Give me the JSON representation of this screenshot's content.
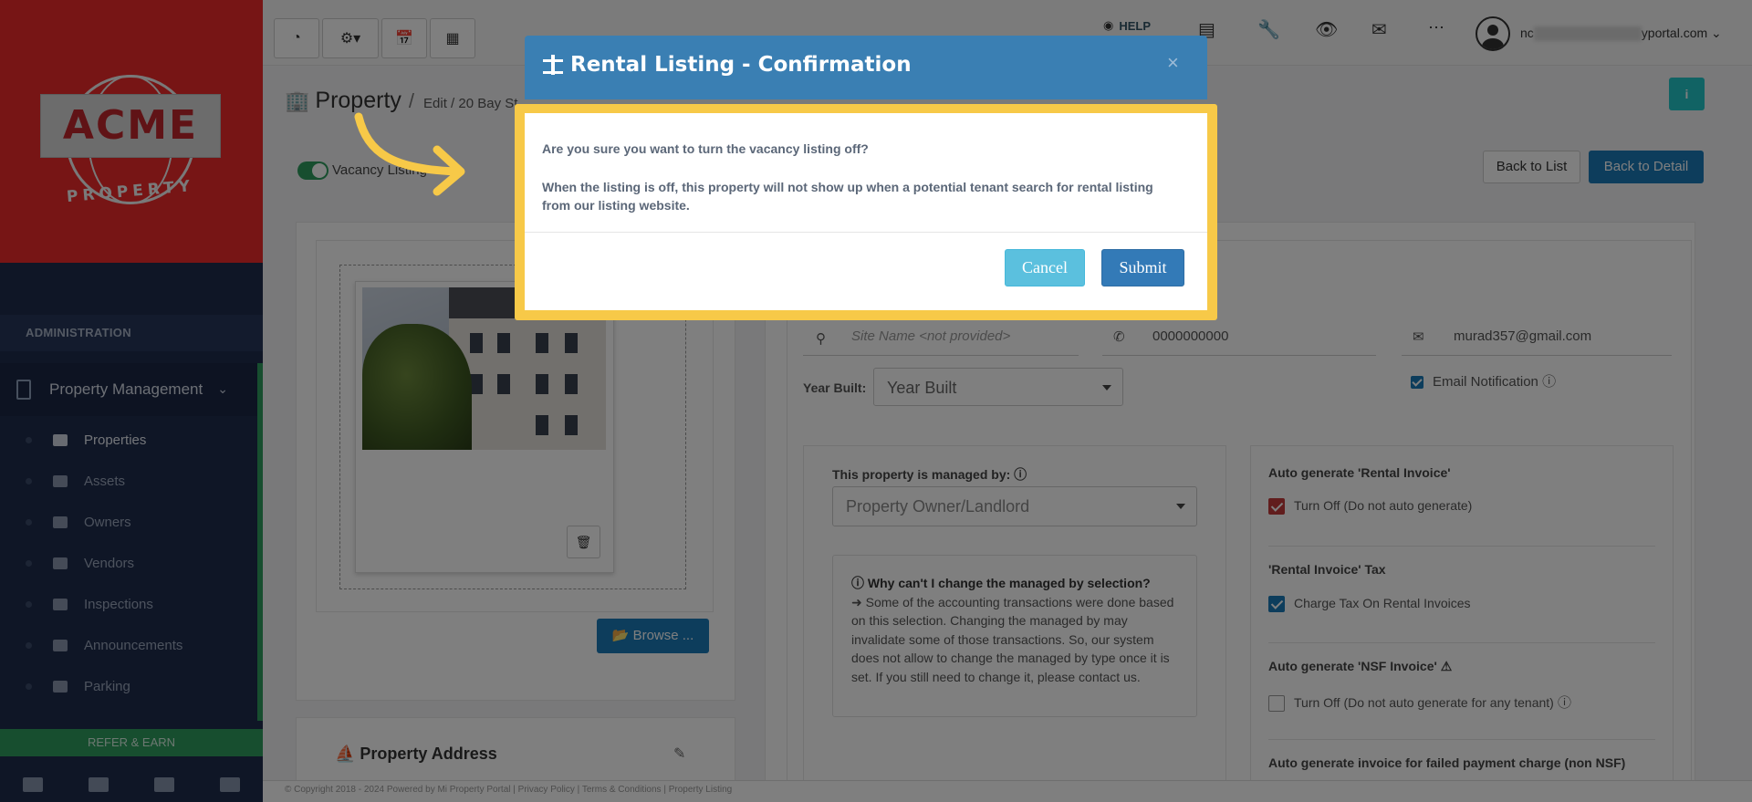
{
  "brand": {
    "logo_text": "ACME",
    "logo_sub": "PROPERTY"
  },
  "sidebar": {
    "section_label": "ADMINISTRATION",
    "group_label": "Property Management",
    "items": [
      {
        "label": "Properties",
        "icon": "home-icon",
        "active": true
      },
      {
        "label": "Assets",
        "icon": "box-icon"
      },
      {
        "label": "Owners",
        "icon": "user-icon"
      },
      {
        "label": "Vendors",
        "icon": "briefcase-icon"
      },
      {
        "label": "Inspections",
        "icon": "search-plus-icon"
      },
      {
        "label": "Announcements",
        "icon": "bullhorn-icon"
      },
      {
        "label": "Parking",
        "icon": "car-icon"
      }
    ],
    "refer_label": "REFER & EARN",
    "bottom_icons": [
      "envelope-icon",
      "briefcase-icon",
      "user-icon",
      "calculator-icon"
    ]
  },
  "topbar": {
    "left_buttons": [
      "dashboard-icon",
      "gear-dropdown-icon",
      "calendar-icon",
      "calculator-icon"
    ],
    "help_label": "HELP",
    "user_email_prefix": "nc",
    "user_email_suffix": "yportal.com"
  },
  "page": {
    "title": "Property",
    "separator": "/",
    "breadcrumb": "Edit / 20 Bay St",
    "vacancy_label": "Vacancy Listing",
    "back_to_list": "Back to List",
    "back_to_detail": "Back to Detail",
    "browse_label": "Browse ...",
    "address_title": "Property Address"
  },
  "form": {
    "site_name_placeholder": "Site Name  <not provided>",
    "phone": "0000000000",
    "email": "murad357@gmail.com",
    "year_built_label": "Year Built:",
    "year_built_value": "Year Built",
    "email_notification_label": "Email Notification",
    "managed_by_label": "This property is managed by:",
    "managed_by_value": "Property Owner/Landlord",
    "note_title": "Why can't I change the managed by selection?",
    "note_body": "Some of the accounting transactions were done based on this selection. Changing the managed by may invalidate some of those transactions. So, our system does not allow to change the managed by type once it is set. If you still need to change it, please contact us.",
    "auto_rental_label": "Auto generate 'Rental Invoice'",
    "auto_rental_option": "Turn Off (Do not auto generate)",
    "rental_tax_label": "'Rental Invoice' Tax",
    "rental_tax_option": "Charge Tax On Rental Invoices",
    "auto_nsf_label": "Auto generate 'NSF Invoice'",
    "auto_nsf_option": "Turn Off (Do not auto generate for any tenant)",
    "auto_failed_label": "Auto generate invoice for failed payment charge (non NSF)"
  },
  "footer": {
    "text": "© Copyright 2018 - 2024 Powered by Mi Property Portal | Privacy Policy | Terms & Conditions | Property Listing"
  },
  "modal": {
    "title": "Rental Listing - Confirmation",
    "close": "×",
    "message1": "Are you sure you want to turn the vacancy listing off?",
    "message2": "When the listing is off, this property will not show up when a potential tenant search for rental listing from our listing website.",
    "cancel_label": "Cancel",
    "submit_label": "Submit"
  },
  "colors": {
    "sidebar_bg": "#1f2d4d",
    "logo_red": "#ee2b2b",
    "accent_green": "#2e9c5f",
    "primary_blue": "#1a7bb9",
    "modal_header": "#3a7fb3",
    "highlight_yellow": "#f7c948",
    "cancel_cyan": "#5bc0de"
  }
}
